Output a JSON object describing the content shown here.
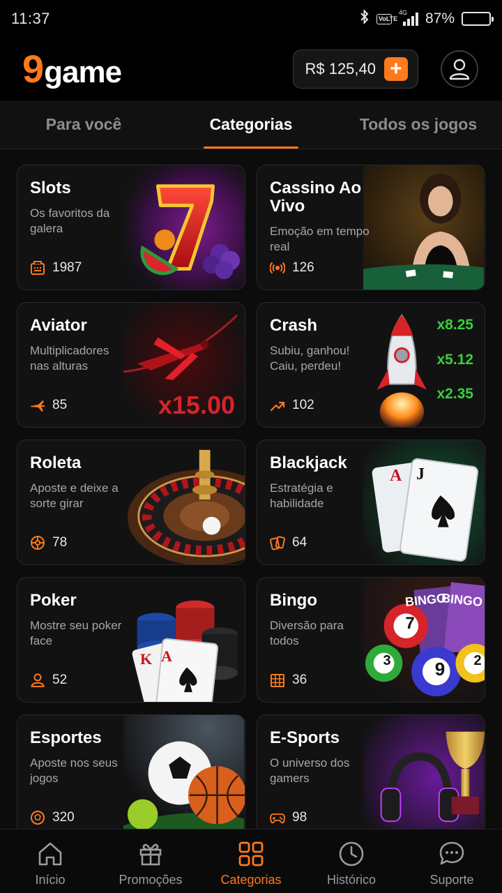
{
  "status_bar": {
    "time": "11:37",
    "battery": "87%",
    "battery_level": 0.87,
    "network": "4G",
    "volte": "VoLTE"
  },
  "header": {
    "logo_number": "9",
    "logo_word": "game",
    "balance": "R$ 125,40",
    "add_icon": "plus-icon",
    "profile_icon": "user-icon"
  },
  "tabs": [
    {
      "label": "Para você",
      "active": false
    },
    {
      "label": "Categorias",
      "active": true
    },
    {
      "label": "Todos os jogos",
      "active": false
    }
  ],
  "categories": [
    {
      "title": "Slots",
      "subtitle": "Os favoritos da galera",
      "count": "1987",
      "icon": "slot-machine-icon"
    },
    {
      "title": "Cassino Ao Vivo",
      "subtitle": "Emoção em tempo real",
      "count": "126",
      "icon": "live-broadcast-icon"
    },
    {
      "title": "Aviator",
      "subtitle": "Multiplicadores nas alturas",
      "count": "85",
      "icon": "airplane-icon",
      "badge": "x15.00"
    },
    {
      "title": "Crash",
      "subtitle": "Subiu, ganhou! Caiu, perdeu!",
      "count": "102",
      "icon": "trending-up-icon",
      "multipliers": [
        "x8.25",
        "x5.12",
        "x2.35"
      ]
    },
    {
      "title": "Roleta",
      "subtitle": "Aposte e deixe a sorte girar",
      "count": "78",
      "icon": "roulette-icon"
    },
    {
      "title": "Blackjack",
      "subtitle": "Estratégia e habilidade",
      "count": "64",
      "icon": "cards-icon",
      "card_labels": [
        "A",
        "J"
      ]
    },
    {
      "title": "Poker",
      "subtitle": "Mostre seu poker face",
      "count": "52",
      "icon": "person-icon",
      "card_labels": [
        "K",
        "A"
      ]
    },
    {
      "title": "Bingo",
      "subtitle": "Diversão para todos",
      "count": "36",
      "icon": "bingo-grid-icon",
      "balls": [
        "7",
        "3",
        "9",
        "2"
      ],
      "tickets": [
        "BINGO",
        "BINGO"
      ]
    },
    {
      "title": "Esportes",
      "subtitle": "Aposte nos seus jogos",
      "count": "320",
      "icon": "soccer-ball-icon"
    },
    {
      "title": "E-Sports",
      "subtitle": "O universo dos gamers",
      "count": "98",
      "icon": "gamepad-icon"
    }
  ],
  "bottom_nav": [
    {
      "label": "Início",
      "icon": "home-icon",
      "active": false
    },
    {
      "label": "Promoções",
      "icon": "gift-icon",
      "active": false
    },
    {
      "label": "Categorias",
      "icon": "grid-icon",
      "active": true
    },
    {
      "label": "Histórico",
      "icon": "clock-icon",
      "active": false
    },
    {
      "label": "Suporte",
      "icon": "chat-icon",
      "active": false
    }
  ],
  "colors": {
    "accent": "#ff7a1a",
    "background": "#0c0c0d",
    "card": "#121213",
    "green": "#3ccf3c",
    "red": "#d6242a"
  }
}
